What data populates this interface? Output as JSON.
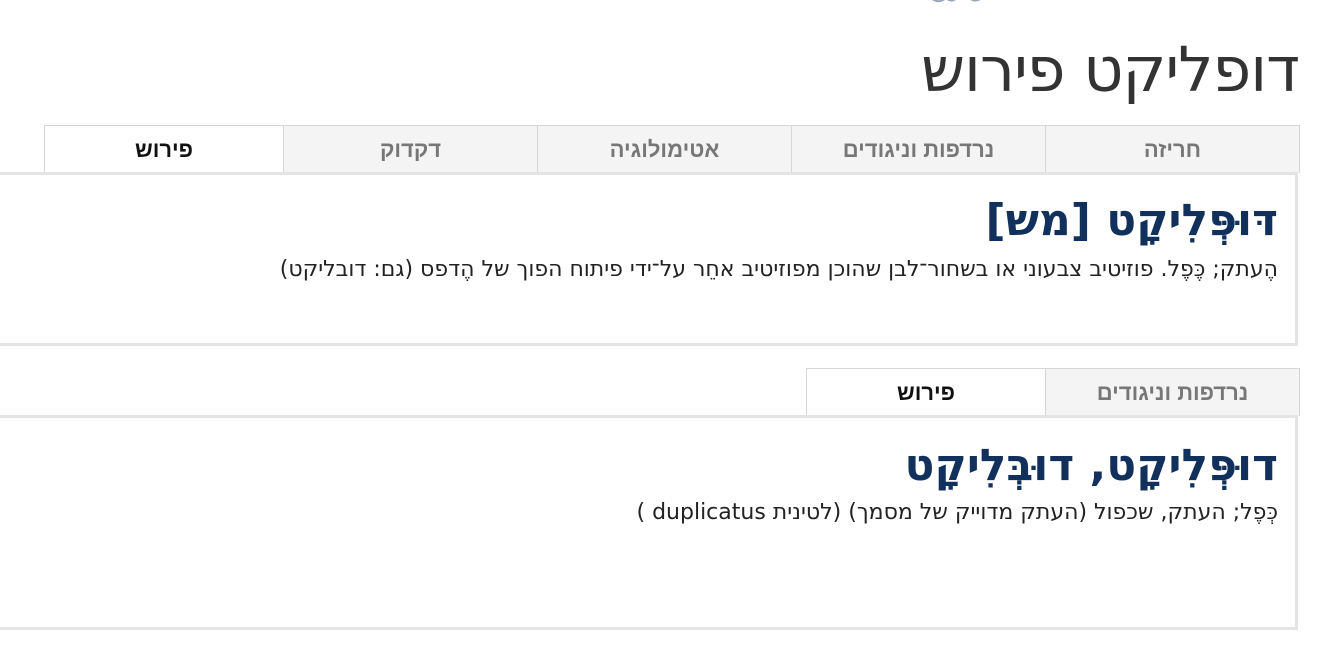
{
  "page": {
    "title": "דופליקט פירוש"
  },
  "entries": [
    {
      "tabs": [
        {
          "label": "פירוש",
          "active": true
        },
        {
          "label": "דקדוק",
          "active": false
        },
        {
          "label": "אטימולוגיה",
          "active": false
        },
        {
          "label": "נרדפות וניגודים",
          "active": false
        },
        {
          "label": "חריזה",
          "active": false
        }
      ],
      "headword": "דּוּפְּלִיקָט [מש]",
      "definition": "הֶעתק; כֶּפֶל. פוזיטיב צבעוני או בשחור־לבן שהוכן מפוזיטיב אחֵר על־ידי פיתוח הפוך של הֶדפס (גם: דובליקט)"
    },
    {
      "tabs": [
        {
          "label": "פירוש",
          "active": true
        },
        {
          "label": "נרדפות וניגודים",
          "active": false
        }
      ],
      "headword": "דוּפְּלִיקָט, דוּבְּלִיקָט",
      "definition": "כְּפֶל; העתק, שכפול (העתק מדוייק של מסמך) (לטינית duplicatus )"
    }
  ],
  "colors": {
    "headword": "#11305c",
    "tab_active_bg": "#ffffff",
    "tab_inactive_bg": "#f4f4f4",
    "border": "#e4e4e4"
  }
}
